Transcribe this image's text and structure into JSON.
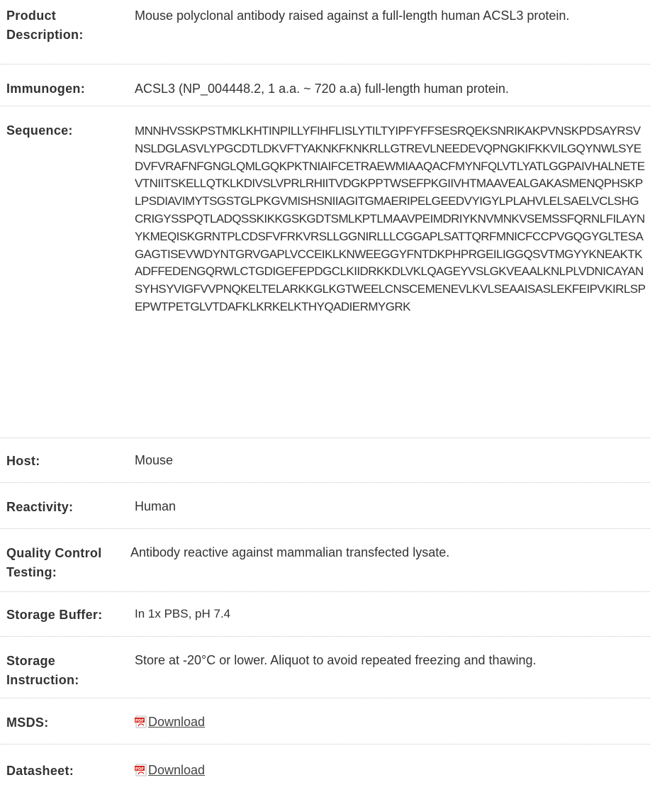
{
  "rows": [
    {
      "key": "product_description",
      "label": "Product Description:",
      "value": "Mouse polyclonal antibody raised against a full-length human ACSL3 protein."
    },
    {
      "key": "immunogen",
      "label": "Immunogen:",
      "value": "ACSL3 (NP_004448.2, 1 a.a. ~ 720 a.a) full-length human protein."
    },
    {
      "key": "sequence",
      "label": "Sequence:",
      "value": "MNNHVSSKPSTMKLKHTINPILLYFIHFLISLYTILTYIPFYFFSESRQEKSNRIKAKPVNSKPDSAYRSVNSLDGLASVLYPGCDTLDKVFTYAKNKFKNKRLLGTREVLNEEDEVQPNGKIFKKVILGQYNWLSYEDVFVRAFNFGNGLQMLGQKPKTNIAIFCETRAEWMIAAQACFMYNFQLVTLYATLGGPAIVHALNETEVTNIITSKELLQTKLKDIVSLVPRLRHIITVDGKPPTWSEFPKGIIVHTMAAVEALGAKASMENQPHSKPLPSDIAVIMYTSGSTGLPKGVMISHSNIIAGITGMAERIPELGEEDVYIGYLPLAHVLELSAELVCLSHGCRIGYSSPQTLADQSSKIKKGSKGDTSMLKPTLMAAVPEIMDRIYKNVMNKVSEMSSFQRNLFILAYNYKMEQISKGRNTPLCDSFVFRKVRSLLGGNIRLLLCGGAPLSATTQRFMNICFCCPVGQGYGLTESAGAGTISEVWDYNTGRVGAPLVCCEIKLKNWEEGGYFNTDKPHPRGEILIGGQSVTMGYYKNEAKTKADFFEDENGQRWLCTGDIGEFEPDGCLKIIDRKKDLVKLQAGEYVSLGKVEAALKNLPLVDNICAYANSYHSYVIGFVVPNQKELTELARKKGLKGTWEELCNSCEMENEVLKVLSEAAISASLEKFEIPVKIRLSPEPWTPETGLVTDAFKLKRKELKTHYQADIERMYGRK"
    },
    {
      "key": "host",
      "label": "Host:",
      "value": "Mouse"
    },
    {
      "key": "reactivity",
      "label": "Reactivity:",
      "value": "Human"
    },
    {
      "key": "qc_testing",
      "label": "Quality Control Testing:",
      "value": "Antibody reactive against mammalian transfected lysate."
    },
    {
      "key": "storage_buffer",
      "label": "Storage Buffer:",
      "value": "In 1x PBS, pH 7.4"
    },
    {
      "key": "storage_instruction",
      "label": "Storage Instruction:",
      "value": "Store at -20°C or lower. Aliquot to avoid repeated freezing and thawing."
    },
    {
      "key": "msds",
      "label": "MSDS:",
      "link_text": "Download",
      "icon": "pdf-icon"
    },
    {
      "key": "datasheet",
      "label": "Datasheet:",
      "link_text": "Download",
      "icon": "pdf-icon"
    }
  ],
  "colors": {
    "text": "#333333",
    "divider": "#c8c8c8",
    "pdf_icon_red": "#d9261c"
  }
}
